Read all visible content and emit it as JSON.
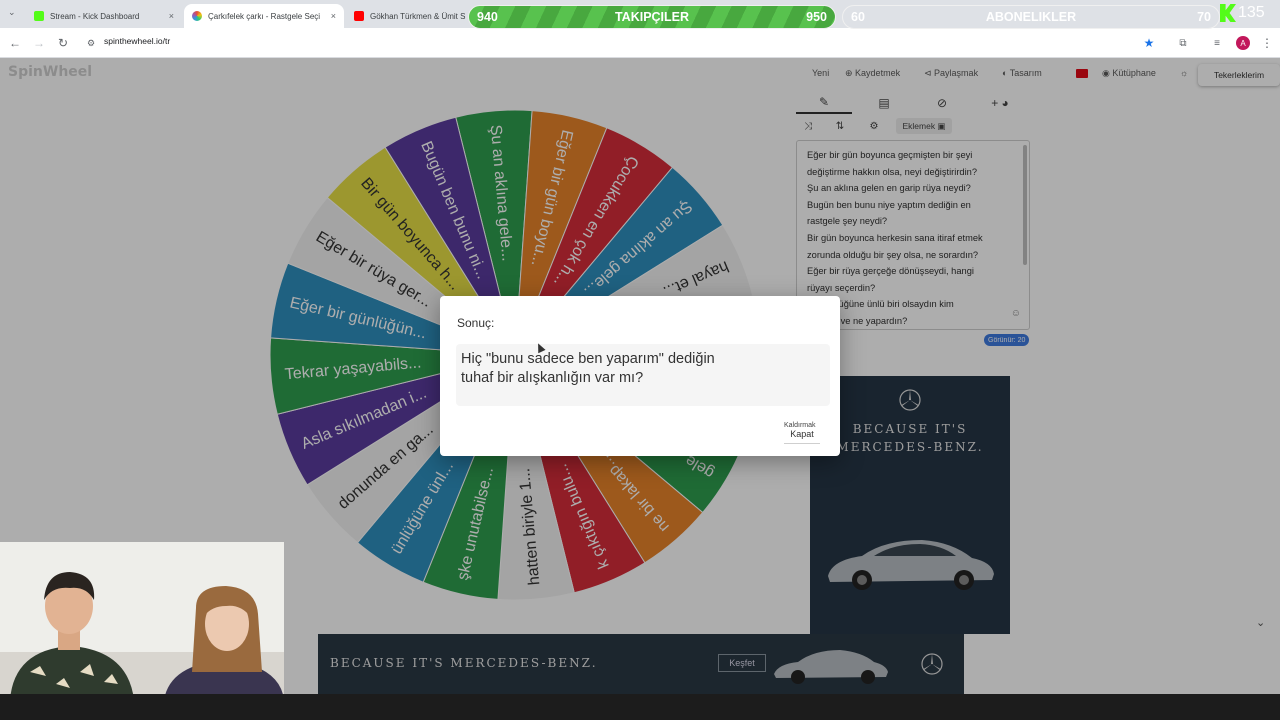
{
  "browser": {
    "tabs": [
      {
        "title": "Stream - Kick Dashboard",
        "favicon_color": "#53fc18",
        "active": false
      },
      {
        "title": "Çarkıfelek çarkı - Rastgele Seçi",
        "favicon_color": "#e8a63c",
        "active": true
      },
      {
        "title": "Gökhan Türkmen & Ümit S",
        "favicon_color": "#ff0000",
        "active": false
      }
    ],
    "close_glyph": "×",
    "url": "spinthewheel.io/tr"
  },
  "overlay": {
    "followers": {
      "label": "TAKIPÇILER",
      "current": "940",
      "goal": "950",
      "fill": 0.9
    },
    "subscribers": {
      "label": "ABONELIKLER",
      "current": "60",
      "goal": "70",
      "fill": 0.84
    },
    "viewer_count": "135"
  },
  "site": {
    "logo": "SpinWheel",
    "nav": [
      "Yeni",
      "Kaydetmek",
      "Paylaşmak",
      "Tasarım",
      "Kütüphane"
    ],
    "my_wheels": "Tekerleklerim"
  },
  "panel": {
    "add_label": "Eklemek",
    "entries": [
      "Eğer bir gün boyunca geçmişten bir şeyi",
      "değiştirme hakkın olsa, neyi değiştirirdin?",
      "Şu an aklına gelen en garip rüya neydi?",
      "Bugün ben bunu niye yaptım dediğin en",
      "rastgele şey neydi?",
      "Bir gün boyunca herkesin sana itiraf etmek",
      "zorunda olduğu bir şey olsa, ne sorardın?",
      "Eğer bir rüya gerçeğe dönüşseydi, hangi",
      "rüyayı seçerdin?",
      "Bir günlüğüne ünlü biri olsaydın kim",
      "olurdun ve ne yapardın?"
    ],
    "visible_count_label": "Görünür: 20"
  },
  "wheel": {
    "segments": [
      {
        "label": "Şu an aklına gele...",
        "color": "#2e9e4f"
      },
      {
        "label": "Eğer bir gün boyu...",
        "color": "#e8832a"
      },
      {
        "label": "Çocukken en çok h...",
        "color": "#d62d3a"
      },
      {
        "label": "Şu an aklına gele...",
        "color": "#2f8fbf"
      },
      {
        "label": "hayal et...",
        "color": "#f2f2f2"
      },
      {
        "label": "",
        "color": "#e6df46"
      },
      {
        "label": "",
        "color": "#5b3b9e"
      },
      {
        "label": "gele...",
        "color": "#2e9e4f"
      },
      {
        "label": "ne bir lakap...",
        "color": "#e8832a"
      },
      {
        "label": "k çıktığın bulu...",
        "color": "#d62d3a"
      },
      {
        "label": "hatten biriyle 1...",
        "color": "#f2f2f2"
      },
      {
        "label": "şke unutabilse...",
        "color": "#2e9e4f"
      },
      {
        "label": "ünlüğüne ünl...",
        "color": "#2f8fbf"
      },
      {
        "label": "donunda en ga...",
        "color": "#f2f2f2"
      },
      {
        "label": "Asla sıkılmadan i...",
        "color": "#5b3b9e"
      },
      {
        "label": "Tekrar yaşayabils...",
        "color": "#2e9e4f"
      },
      {
        "label": "Eğer bir günlüğün...",
        "color": "#2f8fbf"
      },
      {
        "label": "Eğer bir rüya ger...",
        "color": "#f2f2f2"
      },
      {
        "label": "Bir gün boyunca h...",
        "color": "#e6df46"
      },
      {
        "label": "Bugün ben bunu ni...",
        "color": "#5b3b9e"
      }
    ]
  },
  "modal": {
    "title": "Sonuç:",
    "result": "Hiç \"bunu sadece ben yaparım\" dediğin tuhaf bir alışkanlığın var mı?",
    "remove_label": "Kaldırmak",
    "close_label": "Kapat"
  },
  "ads": {
    "side_text_1": "BECAUSE IT'S",
    "side_text_2": "MERCEDES-BENZ.",
    "bottom_text": "BECAUSE IT'S MERCEDES-BENZ.",
    "cta": "Keşfet"
  }
}
